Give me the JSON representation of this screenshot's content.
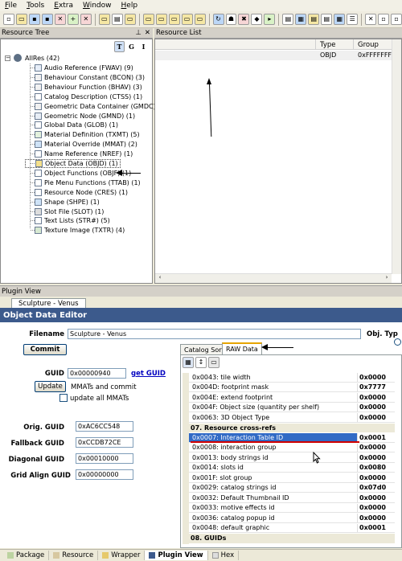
{
  "menu": [
    "File",
    "Tools",
    "Extra",
    "Window",
    "Help"
  ],
  "resource_tree": {
    "title": "Resource Tree",
    "tg_buttons": [
      "T",
      "G",
      "I"
    ],
    "root": "AllRes (42)",
    "items": [
      "Audio Reference (FWAV) (9)",
      "Behaviour Constant (BCON) (3)",
      "Behaviour Function (BHAV) (3)",
      "Catalog Description (CTSS) (1)",
      "Geometric Data Container (GMDC) (1)",
      "Geometric Node (GMND) (1)",
      "Global Data (GLOB) (1)",
      "Material Definition (TXMT) (5)",
      "Material Override (MMAT) (2)",
      "Name Reference (NREF) (1)",
      "Object Data (OBJD) (1)",
      "Object Functions (OBJF) (1)",
      "Pie Menu Functions (TTAB) (1)",
      "Resource Node (CRES) (1)",
      "Shape (SHPE) (1)",
      "Slot File (SLOT) (1)",
      "Text Lists (STR#) (5)",
      "Texture Image (TXTR) (4)"
    ]
  },
  "resource_list": {
    "title": "Resource List",
    "columns": [
      "",
      "Type",
      "Group"
    ],
    "rows": [
      [
        "",
        "OBJD",
        "0xFFFFFFFF"
      ]
    ]
  },
  "plugin_view": {
    "title": "Plugin View",
    "doc_tab": "Sculpture - Venus",
    "editor_title": "Object Data Editor",
    "filename_label": "Filename",
    "filename_value": "Sculpture - Venus",
    "obj_type_label": "Obj. Typ",
    "commit_label": "Commit",
    "guid_label": "GUID",
    "guid_value": "0x00000940",
    "get_guid_label": "get GUID",
    "update_label": "Update",
    "mmats_commit_label": "MMATs and commit",
    "update_all_label": "update all MMATs",
    "orig_guid_label": "Orig. GUID",
    "orig_guid_value": "0xAC6CC548",
    "fallback_guid_label": "Fallback GUID",
    "fallback_guid_value": "0xCCDB72CE",
    "diagonal_guid_label": "Diagonal GUID",
    "diagonal_guid_value": "0x00010000",
    "grid_align_guid_label": "Grid Align GUID",
    "grid_align_guid_value": "0x00000000",
    "tabs": [
      "Catalog Sort",
      "RAW Data"
    ],
    "grid": [
      {
        "k": "0x0043: tile width",
        "v": "0x0000"
      },
      {
        "k": "0x004D: footprint mask",
        "v": "0x7777"
      },
      {
        "k": "0x004E: extend footprint",
        "v": "0x0000"
      },
      {
        "k": "0x004F: Object size (quantity per shelf)",
        "v": "0x0000"
      },
      {
        "k": "0x0063: 3D Object Type",
        "v": "0x0000"
      },
      {
        "cat": "07. Resource cross-refs"
      },
      {
        "k": "0x0007: Interaction Table ID",
        "v": "0x0001",
        "sel": true
      },
      {
        "k": "0x0008: interaction group",
        "v": "0x0000"
      },
      {
        "k": "0x0013: body strings id",
        "v": "0x0000"
      },
      {
        "k": "0x0014: slots id",
        "v": "0x0080"
      },
      {
        "k": "0x001F: slot group",
        "v": "0x0000"
      },
      {
        "k": "0x0029: catalog strings id",
        "v": "0x07d0"
      },
      {
        "k": "0x0032: Default Thumbnail ID",
        "v": "0x0000"
      },
      {
        "k": "0x0033: motive effects id",
        "v": "0x0000"
      },
      {
        "k": "0x0036: catalog popup id",
        "v": "0x0000"
      },
      {
        "k": "0x0048: default graphic",
        "v": "0x0001"
      },
      {
        "cat": "08. GUIDs"
      }
    ]
  },
  "bottom_tabs": [
    "Package",
    "Resource",
    "Wrapper",
    "Plugin View",
    "Hex"
  ],
  "colors": {
    "accent": "#316ac5",
    "header_blue": "#3c5a8c",
    "selection": "#316ac5",
    "underline_red": "#d00000"
  }
}
